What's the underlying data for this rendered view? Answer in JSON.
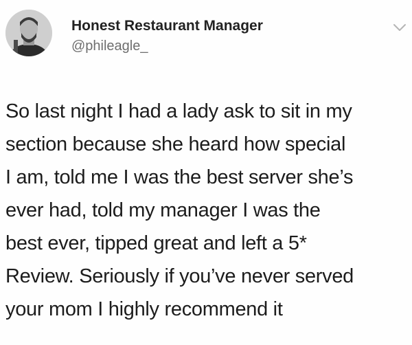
{
  "author": {
    "display_name": "Honest Restaurant Manager",
    "handle": "@phileagle_",
    "avatar_icon": "profile-photo"
  },
  "menu": {
    "icon": "chevron-down-icon"
  },
  "tweet": {
    "lines": [
      "So last night I had a lady ask to sit in my",
      "section because she heard how special",
      "I am, told me I was the best server she’s",
      "ever had, told my manager I was the",
      "best ever, tipped great and left a 5*",
      "Review. Seriously if you’ve never served",
      "your mom I highly recommend it"
    ]
  }
}
